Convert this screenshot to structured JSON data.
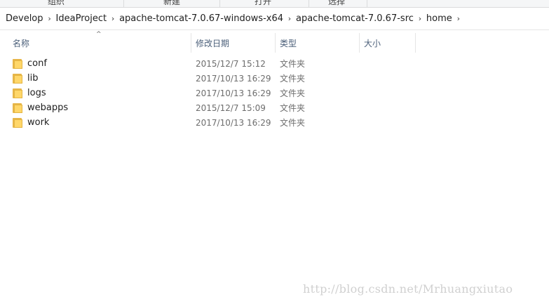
{
  "ribbon": {
    "groups": [
      "组织",
      "新建",
      "打开",
      "选择"
    ]
  },
  "breadcrumb": {
    "items": [
      "Develop",
      "IdeaProject",
      "apache-tomcat-7.0.67-windows-x64",
      "apache-tomcat-7.0.67-src",
      "home"
    ],
    "separator": "›"
  },
  "columns": {
    "name": "名称",
    "date_modified": "修改日期",
    "type": "类型",
    "size": "大小",
    "sort_indicator": "^"
  },
  "files": [
    {
      "name": "conf",
      "modified": "2015/12/7 15:12",
      "type": "文件夹",
      "icon": "folder-icon"
    },
    {
      "name": "lib",
      "modified": "2017/10/13 16:29",
      "type": "文件夹",
      "icon": "folder-icon"
    },
    {
      "name": "logs",
      "modified": "2017/10/13 16:29",
      "type": "文件夹",
      "icon": "folder-icon"
    },
    {
      "name": "webapps",
      "modified": "2015/12/7 15:09",
      "type": "文件夹",
      "icon": "folder-icon"
    },
    {
      "name": "work",
      "modified": "2017/10/13 16:29",
      "type": "文件夹",
      "icon": "folder-icon"
    }
  ],
  "watermark": "http://blog.csdn.net/Mrhuangxiutao",
  "colors": {
    "header_text": "#4c607a",
    "folder_front": "#ffd76a",
    "folder_back": "#e7b64a",
    "meta_text": "#6d6d6d"
  }
}
